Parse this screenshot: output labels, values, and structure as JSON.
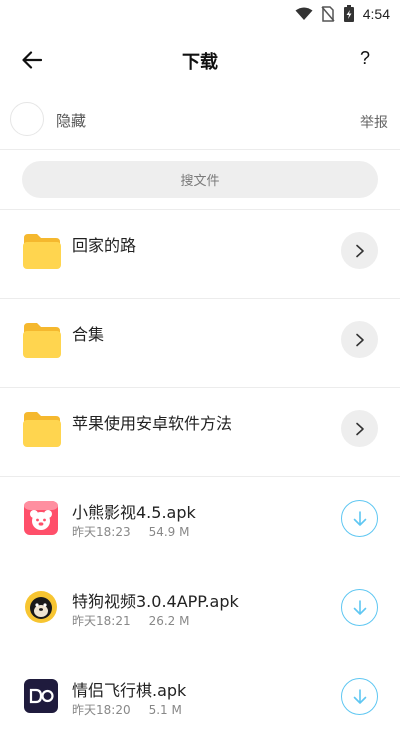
{
  "status_bar": {
    "time": "4:54"
  },
  "header": {
    "title": "下载",
    "help": "?"
  },
  "owner": {
    "name": "隐藏",
    "report": "举报"
  },
  "search": {
    "placeholder": "搜文件"
  },
  "folders": [
    {
      "name": "回家的路",
      "icon": "folder-icon"
    },
    {
      "name": "合集",
      "icon": "folder-icon"
    },
    {
      "name": "苹果使用安卓软件方法",
      "icon": "folder-icon"
    }
  ],
  "files": [
    {
      "name": "小熊影视4.5.apk",
      "time": "昨天18:23",
      "size": "54.9 M",
      "icon": "bear-app-icon"
    },
    {
      "name": "特狗视频3.0.4APP.apk",
      "time": "昨天18:21",
      "size": "26.2 M",
      "icon": "dog-app-icon"
    },
    {
      "name": "情侣飞行棋.apk",
      "time": "昨天18:20",
      "size": "5.1 M",
      "icon": "do-app-icon"
    }
  ],
  "colors": {
    "accent": "#5fc7f2",
    "folder": "#ffd54f",
    "folder_tab": "#f5b82e"
  }
}
